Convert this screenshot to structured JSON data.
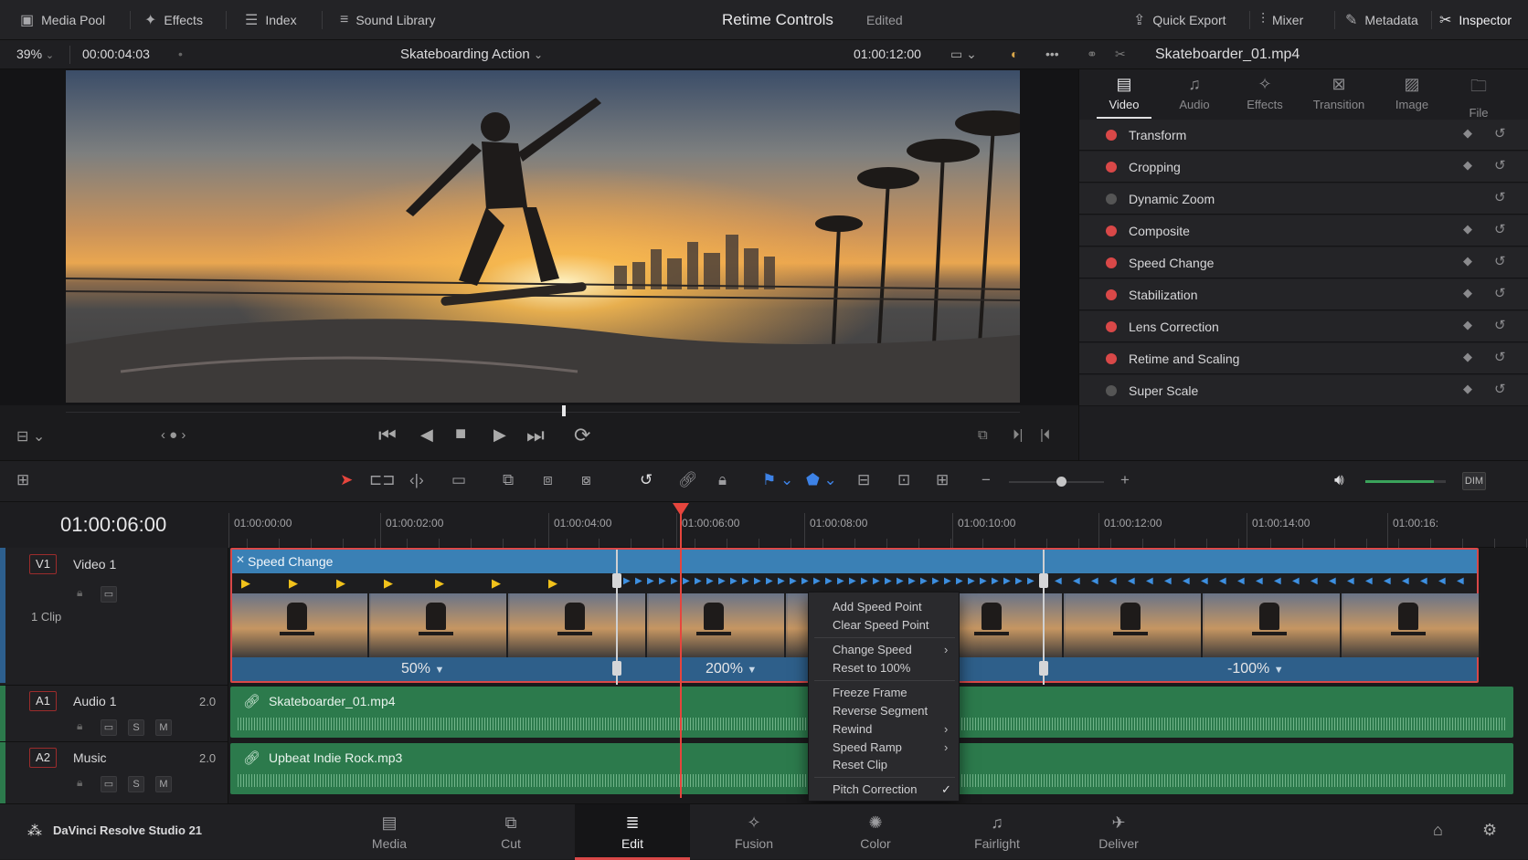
{
  "topbar": {
    "media_pool": "Media Pool",
    "effects": "Effects",
    "index": "Index",
    "sound_library": "Sound Library",
    "title": "Retime Controls",
    "status": "Edited",
    "quick_export": "Quick Export",
    "mixer": "Mixer",
    "metadata": "Metadata",
    "inspector": "Inspector"
  },
  "viewer": {
    "zoom": "39%",
    "timecode": "00:00:04:03",
    "timeline_name": "Skateboarding Action",
    "record_timecode": "01:00:12:00",
    "playhead_progress": 0.52
  },
  "inspector": {
    "clip_name": "Skateboarder_01.mp4",
    "tabs": [
      "Video",
      "Audio",
      "Effects",
      "Transition",
      "Image",
      "File"
    ],
    "sections": [
      {
        "label": "Transform",
        "enabled": true
      },
      {
        "label": "Cropping",
        "enabled": true
      },
      {
        "label": "Dynamic Zoom",
        "enabled": false
      },
      {
        "label": "Composite",
        "enabled": true
      },
      {
        "label": "Speed Change",
        "enabled": true
      },
      {
        "label": "Stabilization",
        "enabled": true
      },
      {
        "label": "Lens Correction",
        "enabled": true
      },
      {
        "label": "Retime and Scaling",
        "enabled": true
      },
      {
        "label": "Super Scale",
        "enabled": false
      }
    ]
  },
  "timeline": {
    "current_timecode": "01:00:06:00",
    "ruler": [
      "01:00:00:00",
      "01:00:02:00",
      "01:00:04:00",
      "01:00:06:00",
      "01:00:08:00",
      "01:00:10:00",
      "01:00:12:00",
      "01:00:14:00",
      "01:00:16:"
    ],
    "tracks": {
      "v1": {
        "badge": "V1",
        "name": "Video 1",
        "clips": "1 Clip"
      },
      "a1": {
        "badge": "A1",
        "name": "Audio 1",
        "channels": "2.0"
      },
      "a2": {
        "badge": "A2",
        "name": "Music",
        "channels": "2.0"
      }
    },
    "solo": "S",
    "mute": "M",
    "video_clip": {
      "title": "Speed Change",
      "speeds": [
        "50%",
        "200%",
        "-100%"
      ]
    },
    "audio_clip_1": "Skateboarder_01.mp4",
    "audio_clip_2": "Upbeat Indie Rock.mp3",
    "volume_label": "DIM",
    "volume_level": 0.85
  },
  "context_menu": {
    "items": [
      "Add Speed Point",
      "Clear Speed Point",
      "Change Speed",
      "Reset to 100%",
      "Freeze Frame",
      "Reverse Segment",
      "Rewind",
      "Speed Ramp",
      "Reset Clip",
      "Pitch Correction"
    ]
  },
  "bottom": {
    "app_name": "DaVinci Resolve Studio 21",
    "pages": [
      "Media",
      "Cut",
      "Edit",
      "Fusion",
      "Color",
      "Fairlight",
      "Deliver"
    ],
    "active_page": "Edit"
  },
  "colors": {
    "accent_red": "#d94848",
    "clip_blue": "#3a80b5",
    "audio_green": "#2c7a4c"
  }
}
